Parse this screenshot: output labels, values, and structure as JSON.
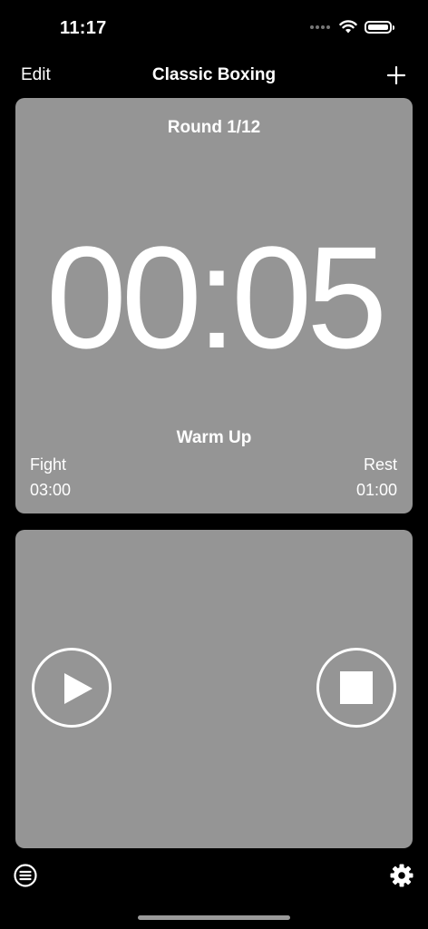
{
  "status_bar": {
    "time": "11:17",
    "wifi_icon": "wifi-icon",
    "battery_icon": "battery-icon"
  },
  "nav": {
    "edit_label": "Edit",
    "title": "Classic Boxing",
    "add_icon": "plus-icon"
  },
  "timer": {
    "round": "Round 1/12",
    "time": "00:05",
    "phase": "Warm Up",
    "fight_label": "Fight",
    "fight_value": "03:00",
    "rest_label": "Rest",
    "rest_value": "01:00"
  },
  "controls": {
    "play_icon": "play-icon",
    "stop_icon": "stop-icon"
  },
  "bottom_bar": {
    "list_icon": "list-icon",
    "settings_icon": "gear-icon"
  },
  "colors": {
    "background": "#000000",
    "card": "#959595",
    "foreground": "#ffffff"
  }
}
